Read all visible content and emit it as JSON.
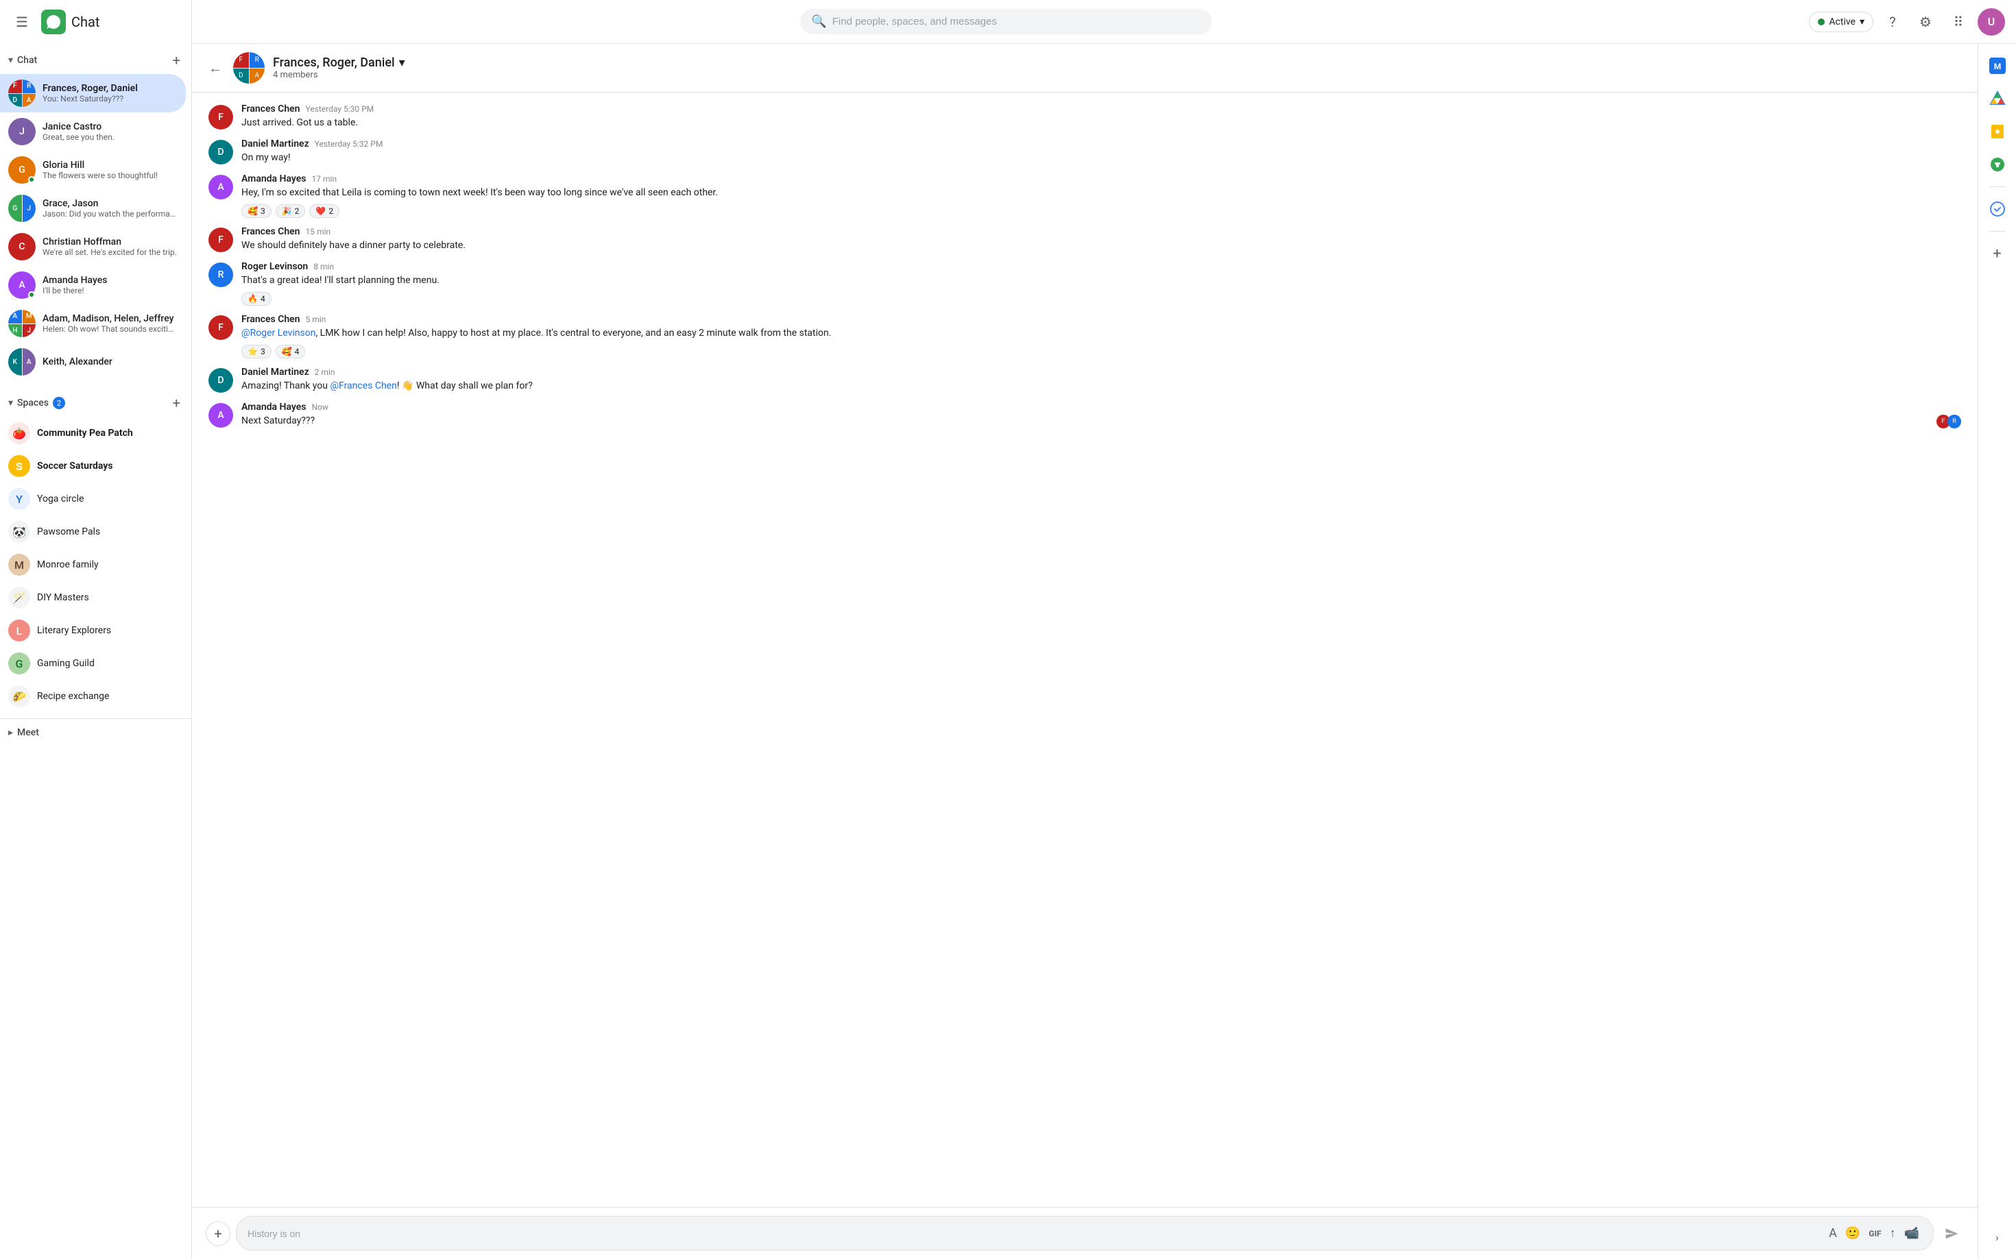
{
  "app": {
    "title": "Chat",
    "logo_color": "#34a853"
  },
  "topbar": {
    "search_placeholder": "Find people, spaces, and messages",
    "status_label": "Active",
    "status_color": "#1e8e3e"
  },
  "sidebar": {
    "chat_section": "Chat",
    "spaces_section": "Spaces",
    "spaces_badge": "2",
    "meet_section": "Meet",
    "chat_items": [
      {
        "id": "frances-roger-daniel",
        "name": "Frances, Roger, Daniel",
        "preview": "You: Next Saturday???",
        "active": true,
        "type": "group"
      },
      {
        "id": "janice-castro",
        "name": "Janice Castro",
        "preview": "Great, see you then.",
        "active": false,
        "type": "single"
      },
      {
        "id": "gloria-hill",
        "name": "Gloria Hill",
        "preview": "The flowers were so thoughtful!",
        "active": false,
        "type": "single",
        "online": true
      },
      {
        "id": "grace-jason",
        "name": "Grace, Jason",
        "preview": "Jason: Did you watch the performan …",
        "active": false,
        "type": "group"
      },
      {
        "id": "christian-hoffman",
        "name": "Christian Hoffman",
        "preview": "We're all set.  He's excited for the trip.",
        "active": false,
        "type": "single"
      },
      {
        "id": "amanda-hayes",
        "name": "Amanda Hayes",
        "preview": "I'll be there!",
        "active": false,
        "type": "single",
        "online": true
      },
      {
        "id": "adam-madison-helen-jeffrey",
        "name": "Adam, Madison, Helen, Jeffrey",
        "preview": "Helen: Oh wow! That sounds exciting …",
        "active": false,
        "type": "group"
      },
      {
        "id": "keith-alexander",
        "name": "Keith, Alexander",
        "preview": "",
        "active": false,
        "type": "group"
      }
    ],
    "space_items": [
      {
        "id": "community-pea-patch",
        "name": "Community Pea Patch",
        "icon": "🍅",
        "bold": true
      },
      {
        "id": "soccer-saturdays",
        "name": "Soccer Saturdays",
        "icon": "S",
        "icon_bg": "#fbbc04",
        "bold": true
      },
      {
        "id": "yoga-circle",
        "name": "Yoga circle",
        "icon": "Y",
        "icon_bg": "#a8c7fa",
        "bold": false
      },
      {
        "id": "pawsome-pals",
        "name": "Pawsome Pals",
        "icon": "🐼",
        "bold": false
      },
      {
        "id": "monroe-family",
        "name": "Monroe family",
        "icon": "M",
        "icon_bg": "#e6c9a8",
        "bold": false
      },
      {
        "id": "diy-masters",
        "name": "DIY Masters",
        "icon": "🪄",
        "bold": false
      },
      {
        "id": "literary-explorers",
        "name": "Literary Explorers",
        "icon": "L",
        "icon_bg": "#f28b82",
        "bold": false
      },
      {
        "id": "gaming-guild",
        "name": "Gaming Guild",
        "icon": "G",
        "icon_bg": "#a8d5a2",
        "bold": false
      },
      {
        "id": "recipe-exchange",
        "name": "Recipe exchange",
        "icon": "🌮",
        "bold": false
      }
    ]
  },
  "chat": {
    "title": "Frances, Roger, Daniel",
    "members_count": "4 members",
    "messages": [
      {
        "id": "msg1",
        "sender": "Frances Chen",
        "time": "Yesterday 5:30 PM",
        "text": "Just arrived.  Got us a table.",
        "reactions": []
      },
      {
        "id": "msg2",
        "sender": "Daniel Martinez",
        "time": "Yesterday 5:32 PM",
        "text": "On my way!",
        "reactions": []
      },
      {
        "id": "msg3",
        "sender": "Amanda Hayes",
        "time": "17 min",
        "text": "Hey, I'm so excited that Leila is coming to town next week! It's been way too long since we've all seen each other.",
        "reactions": [
          {
            "emoji": "🥰",
            "count": "3"
          },
          {
            "emoji": "🎉",
            "count": "2"
          },
          {
            "emoji": "❤️",
            "count": "2"
          }
        ]
      },
      {
        "id": "msg4",
        "sender": "Frances Chen",
        "time": "15 min",
        "text": "We should definitely have a dinner party to celebrate.",
        "reactions": []
      },
      {
        "id": "msg5",
        "sender": "Roger Levinson",
        "time": "8 min",
        "text": "That's a great idea! I'll start planning the menu.",
        "reactions": [
          {
            "emoji": "🔥",
            "count": "4"
          }
        ]
      },
      {
        "id": "msg6",
        "sender": "Frances Chen",
        "time": "5 min",
        "text_parts": [
          {
            "type": "mention",
            "text": "@Roger Levinson"
          },
          {
            "type": "normal",
            "text": ", LMK how I can help!  Also, happy to host at my place. It's central to everyone, and an easy 2 minute walk from the station."
          }
        ],
        "reactions": [
          {
            "emoji": "⭐",
            "count": "3"
          },
          {
            "emoji": "🥰",
            "count": "4"
          }
        ]
      },
      {
        "id": "msg7",
        "sender": "Daniel Martinez",
        "time": "2 min",
        "text_parts": [
          {
            "type": "normal",
            "text": "Amazing! Thank you "
          },
          {
            "type": "mention",
            "text": "@Frances Chen"
          },
          {
            "type": "normal",
            "text": "! 👋 What day shall we plan for?"
          }
        ],
        "reactions": []
      },
      {
        "id": "msg8",
        "sender": "Amanda Hayes",
        "time": "Now",
        "text": "Next Saturday???",
        "reactions": [],
        "show_read_avatars": true
      }
    ],
    "input_placeholder": "History is on"
  },
  "right_sidebar": {
    "icons": [
      {
        "name": "google-meet-icon",
        "symbol": "📅",
        "color": "#1a73e8"
      },
      {
        "name": "google-drive-icon",
        "symbol": "▲",
        "color": "#4285f4"
      },
      {
        "name": "google-keep-icon",
        "symbol": "💡",
        "color": "#fbbc04"
      },
      {
        "name": "google-voice-icon",
        "symbol": "📞",
        "color": "#34a853"
      },
      {
        "name": "google-tasks-icon",
        "symbol": "✓",
        "color": "#4285f4"
      }
    ]
  },
  "labels": {
    "add": "+",
    "send": "➤",
    "history_on": "History is on"
  }
}
